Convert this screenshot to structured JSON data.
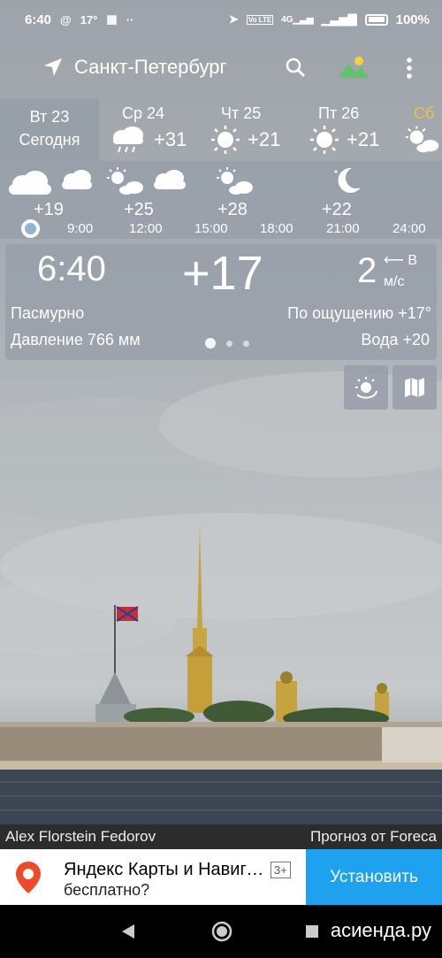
{
  "status_bar": {
    "time": "6:40",
    "temp_indicator": "17°",
    "battery": "100%",
    "signal_label": "4G",
    "volte_label": "Vo LTE"
  },
  "header": {
    "city": "Санкт-Петербург",
    "icons": [
      "location-arrow-icon",
      "search-icon",
      "landscape-icon",
      "more-vert-icon"
    ]
  },
  "days": [
    {
      "name": "Вт 23",
      "sub": "Сегодня"
    },
    {
      "name": "Ср 24",
      "temp": "+31",
      "icon": "rain-cloud-icon"
    },
    {
      "name": "Чт 25",
      "temp": "+21",
      "icon": "sun-icon"
    },
    {
      "name": "Пт 26",
      "temp": "+21",
      "icon": "sun-icon"
    },
    {
      "name": "Сб",
      "icon": "sun-cloud-icon",
      "color": "#f1c040"
    }
  ],
  "hourly": [
    {
      "time": "",
      "temp": "+19",
      "icon": "cloud-icon"
    },
    {
      "time": "9:00",
      "temp": "",
      "icon": "cloud-icon"
    },
    {
      "time": "12:00",
      "temp": "+25",
      "icon": "sun-cloud-icon"
    },
    {
      "time": "15:00",
      "temp": "+28",
      "icon": "sun-cloud-icon"
    },
    {
      "time": "18:00",
      "temp": "",
      "icon": "cloud-icon"
    },
    {
      "time": "21:00",
      "temp": "+22",
      "icon": "moon-icon"
    },
    {
      "time": "24:00",
      "temp": "",
      "icon": "none"
    }
  ],
  "current": {
    "time": "6:40",
    "temp": "+17",
    "wind_speed": "2",
    "wind_dir": "В",
    "wind_unit": "м/с",
    "condition": "Пасмурно",
    "feels_like": "По ощущению +17°",
    "pressure": "Давление 766 мм",
    "water": "Вода +20",
    "page_dots": 3,
    "active_dot": 0
  },
  "credits": {
    "author": "Alex Florstein Fedorov",
    "provider": "Прогноз от Foreca"
  },
  "ad": {
    "title": "Яндекс Карты и Навигатор",
    "subtitle": "бесплатно?",
    "age": "3+",
    "button": "Установить"
  },
  "watermark": "асиенда.ру",
  "colors": {
    "ad_button": "#1ea1ef",
    "saturday": "#f1c040",
    "location_pin": "#f04a2a"
  }
}
